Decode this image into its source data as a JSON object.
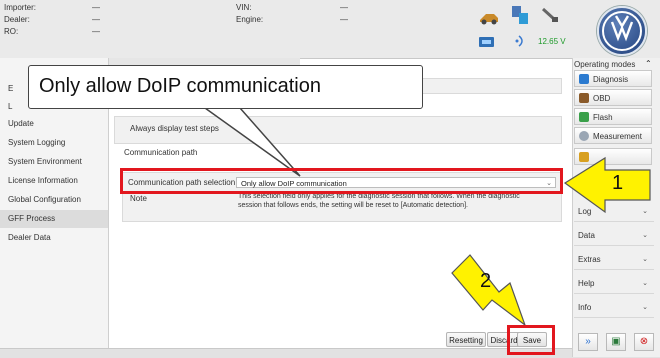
{
  "header": {
    "labels": {
      "importer": "Importer:",
      "dealer": "Dealer:",
      "ro": "RO:",
      "vin": "VIN:",
      "engine": "Engine:"
    },
    "values": {
      "importer": "—",
      "dealer": "—",
      "ro": "—",
      "vin": "—",
      "engine": "—"
    },
    "voltage": "12.65 V"
  },
  "tabs": {
    "partial_label": "G"
  },
  "sidebar": {
    "partial_items": [
      "E",
      "L"
    ],
    "items": [
      "Update",
      "System Logging",
      "System Environment",
      "License Information",
      "Global Configuration",
      "GFF Process",
      "Dealer Data"
    ],
    "active_item": "GFF Process"
  },
  "main": {
    "always_display_label": "Always display test steps",
    "section_label": "Communication path",
    "path_selection_label": "Communication path selection",
    "path_selection_value": "Only allow DoIP communication",
    "note_label": "Note",
    "note_text": "This selection field only applies for the diagnostic session that follows. When the diagnostic session that follows ends, the setting will be reset to [Automatic detection]."
  },
  "buttons": {
    "resetting": "Resetting",
    "discard": "Discard",
    "save": "Save"
  },
  "right_panel": {
    "header": "Operating modes",
    "items": [
      "Diagnosis",
      "OBD",
      "Flash",
      "Measurement"
    ],
    "menus": [
      "Log",
      "Data",
      "Extras",
      "Help",
      "Info"
    ]
  },
  "callout": {
    "text": "Only allow DoIP communication",
    "step1": "1",
    "step2": "2"
  },
  "colors": {
    "highlight": "#e2171e",
    "arrow_fill": "#fff200",
    "active_row": "#dcdcdc"
  }
}
